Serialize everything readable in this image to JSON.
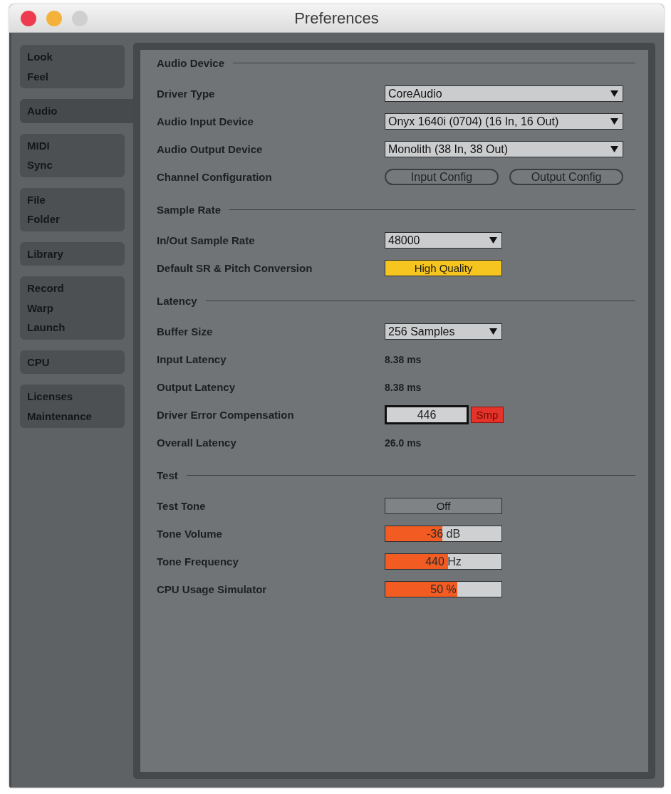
{
  "window": {
    "title": "Preferences",
    "buttons": [
      {
        "kind": "close",
        "disabled": false
      },
      {
        "kind": "minimize",
        "disabled": false
      },
      {
        "kind": "zoom",
        "disabled": true
      }
    ]
  },
  "sidebar": {
    "tabs": [
      {
        "lines": [
          "Look",
          "Feel"
        ],
        "selected": false
      },
      {
        "lines": [
          "Audio"
        ],
        "selected": true
      },
      {
        "lines": [
          "MIDI",
          "Sync"
        ],
        "selected": false
      },
      {
        "lines": [
          "File",
          "Folder"
        ],
        "selected": false
      },
      {
        "lines": [
          "Library"
        ],
        "selected": false
      },
      {
        "lines": [
          "Record",
          "Warp",
          "Launch"
        ],
        "selected": false
      },
      {
        "lines": [
          "CPU"
        ],
        "selected": false
      },
      {
        "lines": [
          "Licenses",
          "Maintenance"
        ],
        "selected": false
      }
    ]
  },
  "panel": {
    "sections": [
      {
        "title": "Audio Device",
        "rows": [
          {
            "kind": "dropdown",
            "label": "Driver Type",
            "value": "CoreAudio"
          },
          {
            "kind": "dropdown",
            "label": "Audio Input Device",
            "value": "Onyx 1640i (0704) (16 In, 16 Out)"
          },
          {
            "kind": "dropdown",
            "label": "Audio Output Device",
            "value": "Monolith (38 In, 38 Out)"
          },
          {
            "kind": "buttons",
            "label": "Channel Configuration",
            "buttons": [
              "Input Config",
              "Output Config"
            ]
          }
        ]
      },
      {
        "title": "Sample Rate",
        "rows": [
          {
            "kind": "dropdown",
            "label": "In/Out Sample Rate",
            "value": "48000"
          },
          {
            "kind": "toggle",
            "label": "Default SR & Pitch Conversion",
            "value": "High Quality",
            "on": true
          }
        ]
      },
      {
        "title": "Latency",
        "rows": [
          {
            "kind": "dropdown",
            "label": "Buffer Size",
            "value": "256 Samples"
          },
          {
            "kind": "readout",
            "label": "Input Latency",
            "value": "8.38 ms"
          },
          {
            "kind": "readout",
            "label": "Output Latency",
            "value": "8.38 ms"
          },
          {
            "kind": "number",
            "label": "Driver Error Compensation",
            "value": "446",
            "unit": "Smp"
          },
          {
            "kind": "readout",
            "label": "Overall Latency",
            "value": "26.0 ms"
          }
        ]
      },
      {
        "title": "Test",
        "rows": [
          {
            "kind": "toggle",
            "label": "Test Tone",
            "value": "Off",
            "on": false
          },
          {
            "kind": "slider",
            "label": "Tone Volume",
            "value": "-36 dB",
            "level": 0.49
          },
          {
            "kind": "slider",
            "label": "Tone Frequency",
            "value": "440 Hz",
            "level": 0.54
          },
          {
            "kind": "slider",
            "label": "CPU Usage Simulator",
            "value": "50 %",
            "level": 0.62
          }
        ]
      }
    ]
  }
}
